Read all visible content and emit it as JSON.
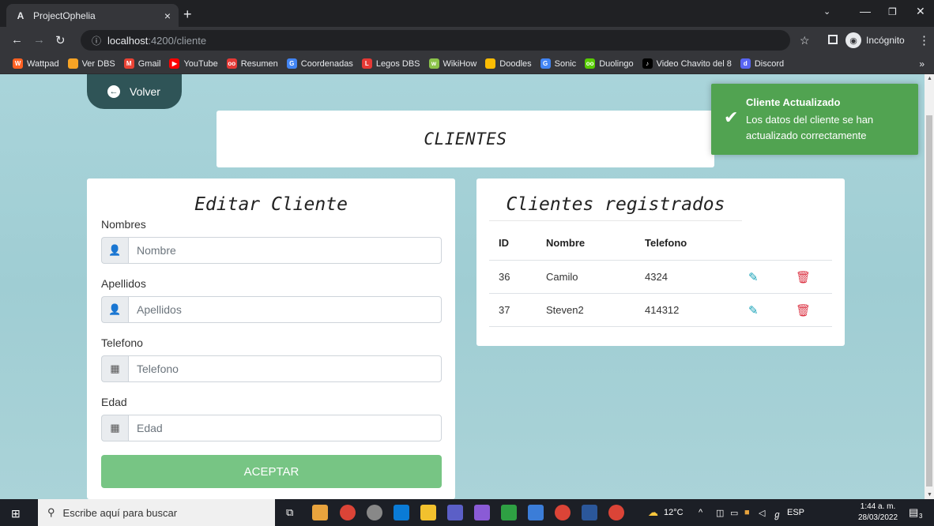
{
  "browser": {
    "tab_title": "ProjectOphelia",
    "tab_favicon": "A",
    "tab_close": "×",
    "new_tab": "+",
    "url_host": "localhost",
    "url_path": ":4200/cliente",
    "incognito_label": "Incógnito",
    "bookmarks": [
      {
        "label": "Wattpad",
        "color": "#ff6122",
        "glyph": "W"
      },
      {
        "label": "Ver DBS",
        "color": "#f7a325",
        "glyph": ""
      },
      {
        "label": "Gmail",
        "color": "#ea4335",
        "glyph": "M"
      },
      {
        "label": "YouTube",
        "color": "#ff0000",
        "glyph": "▶"
      },
      {
        "label": "Resumen",
        "color": "#e53935",
        "glyph": "oo"
      },
      {
        "label": "Coordenadas",
        "color": "#4285f4",
        "glyph": "G"
      },
      {
        "label": "Legos DBS",
        "color": "#e53935",
        "glyph": "L"
      },
      {
        "label": "WikiHow",
        "color": "#8bc34a",
        "glyph": "w"
      },
      {
        "label": "Doodles",
        "color": "#fbbc04",
        "glyph": ""
      },
      {
        "label": "Sonic",
        "color": "#4285f4",
        "glyph": "G"
      },
      {
        "label": "Duolingo",
        "color": "#58cc02",
        "glyph": "oo"
      },
      {
        "label": "Video Chavito del 8",
        "color": "#000000",
        "glyph": "♪"
      },
      {
        "label": "Discord",
        "color": "#5865f2",
        "glyph": "d"
      }
    ]
  },
  "page": {
    "back_label": "Volver",
    "title": "CLIENTES",
    "toast": {
      "title": "Cliente Actualizado",
      "message": "Los datos del cliente se han actualizado correctamente",
      "color": "#51a351"
    },
    "form": {
      "heading": "Editar Cliente",
      "fields": [
        {
          "label": "Nombres",
          "placeholder": "Nombre",
          "icon": "user-icon",
          "glyph": "👤"
        },
        {
          "label": "Apellidos",
          "placeholder": "Apellidos",
          "icon": "user-icon",
          "glyph": "👤"
        },
        {
          "label": "Telefono",
          "placeholder": "Telefono",
          "icon": "calculator-icon",
          "glyph": "▦"
        },
        {
          "label": "Edad",
          "placeholder": "Edad",
          "icon": "calculator-icon",
          "glyph": "▦"
        }
      ],
      "submit_label": "ACEPTAR"
    },
    "list": {
      "heading": "Clientes registrados",
      "columns": [
        "ID",
        "Nombre",
        "Telefono"
      ],
      "rows": [
        {
          "id": "36",
          "nombre": "Camilo",
          "telefono": "4324"
        },
        {
          "id": "37",
          "nombre": "Steven2",
          "telefono": "414312"
        }
      ]
    }
  },
  "taskbar": {
    "search_placeholder": "Escribe aquí para buscar",
    "temperature": "12°C",
    "language": "ESP",
    "time": "1:44 a. m.",
    "date": "28/03/2022",
    "notifications": "3"
  }
}
